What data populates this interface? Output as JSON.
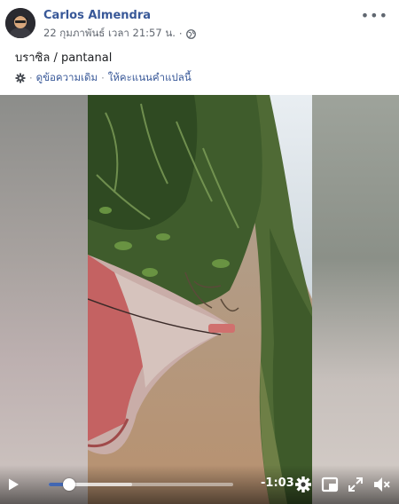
{
  "post": {
    "author": "Carlos Almendra",
    "timestamp": "22 กุมภาพันธ์ เวลา 21:57 น.",
    "separator": "·",
    "privacy_icon": "globe-icon",
    "more_label": "•••",
    "text": "บราซิล / pantanal",
    "translate": {
      "gear_icon": "gear-icon",
      "see_original": "ดูข้อความเดิม",
      "separator": "·",
      "rate_translation": "ให้คะแนนคำแปลนี้"
    }
  },
  "video": {
    "time_remaining": "-1:03",
    "progress": 0.11,
    "buffered": 0.45,
    "icons": [
      "play-icon",
      "settings-icon",
      "picture-in-picture-icon",
      "fullscreen-icon",
      "volume-muted-icon"
    ]
  },
  "colors": {
    "link": "#385898",
    "author": "#385898",
    "progress": "#4267b2"
  }
}
